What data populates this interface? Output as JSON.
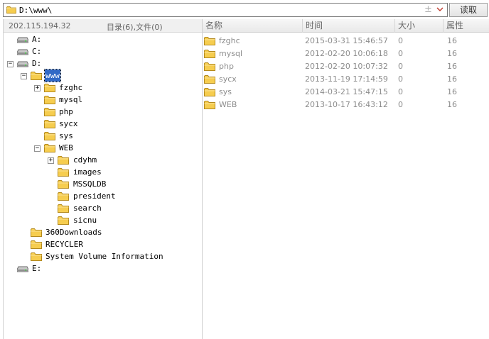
{
  "address": {
    "path": "D:\\www\\",
    "plus_glyph": "±",
    "read_button": "读取"
  },
  "status": {
    "ip": "202.115.194.32",
    "counts": "目录(6),文件(0)"
  },
  "columns": [
    "名称",
    "时间",
    "大小",
    "属性"
  ],
  "tree": {
    "drive_a": "A:",
    "drive_c": "C:",
    "drive_d": "D:",
    "www": "www",
    "fzghc": "fzghc",
    "mysql": "mysql",
    "php": "php",
    "sycx": "sycx",
    "sys": "sys",
    "web": "WEB",
    "cdyhm": "cdyhm",
    "images": "images",
    "mssqldb": "MSSQLDB",
    "president": "president",
    "search": "search",
    "sicnu": "sicnu",
    "downloads": "360Downloads",
    "recycler": "RECYCLER",
    "svi": "System Volume Information",
    "drive_e": "E:"
  },
  "files": [
    {
      "name": "fzghc",
      "time": "2015-03-31 15:46:57",
      "size": "0",
      "attr": "16"
    },
    {
      "name": "mysql",
      "time": "2012-02-20 10:06:18",
      "size": "0",
      "attr": "16"
    },
    {
      "name": "php",
      "time": "2012-02-20 10:07:32",
      "size": "0",
      "attr": "16"
    },
    {
      "name": "sycx",
      "time": "2013-11-19 17:14:59",
      "size": "0",
      "attr": "16"
    },
    {
      "name": "sys",
      "time": "2014-03-21 15:47:15",
      "size": "0",
      "attr": "16"
    },
    {
      "name": "WEB",
      "time": "2013-10-17 16:43:12",
      "size": "0",
      "attr": "16"
    }
  ],
  "icons": {
    "folder": "folder-icon",
    "drive": "drive-icon",
    "dropdown": "chevron-down-icon"
  },
  "colors": {
    "selection": "#3169c6",
    "folder": "#f4c542",
    "text_muted": "#8c8c8c",
    "dropdown": "#c0392b"
  }
}
